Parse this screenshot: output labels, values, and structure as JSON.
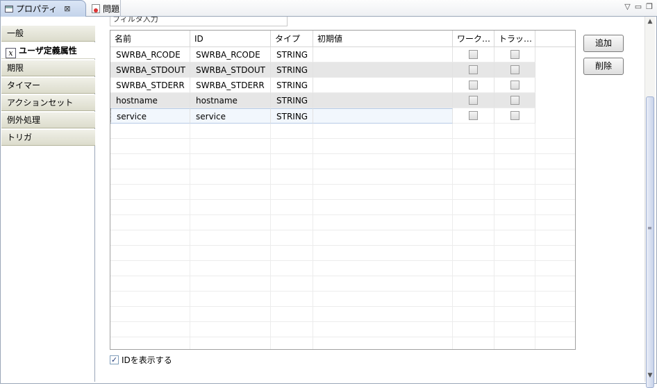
{
  "tabs": {
    "properties": "プロパティ",
    "problems": "問題",
    "close": "⊠"
  },
  "sections": [
    {
      "label": "一般"
    },
    {
      "label": "ユーザ定義属性",
      "selected": true
    },
    {
      "label": "期限"
    },
    {
      "label": "タイマー"
    },
    {
      "label": "アクションセット"
    },
    {
      "label": "例外処理"
    },
    {
      "label": "トリガ"
    }
  ],
  "filter": {
    "placeholder": "フィルタ入力"
  },
  "table": {
    "columns": [
      "名前",
      "ID",
      "タイプ",
      "初期値",
      "ワーク…",
      "トラッ…"
    ],
    "rows": [
      {
        "name": "SWRBA_RCODE",
        "id": "SWRBA_RCODE",
        "type": "STRING",
        "init": "",
        "work": false,
        "track": false
      },
      {
        "name": "SWRBA_STDOUT",
        "id": "SWRBA_STDOUT",
        "type": "STRING",
        "init": "",
        "work": false,
        "track": false
      },
      {
        "name": "SWRBA_STDERR",
        "id": "SWRBA_STDERR",
        "type": "STRING",
        "init": "",
        "work": false,
        "track": false
      },
      {
        "name": "hostname",
        "id": "hostname",
        "type": "STRING",
        "init": "",
        "work": false,
        "track": false
      },
      {
        "name": "service",
        "id": "service",
        "type": "STRING",
        "init": "",
        "work": false,
        "track": false
      }
    ]
  },
  "buttons": {
    "add": "追加",
    "delete": "削除"
  },
  "show_id": {
    "label": "IDを表示する",
    "checked": true
  }
}
